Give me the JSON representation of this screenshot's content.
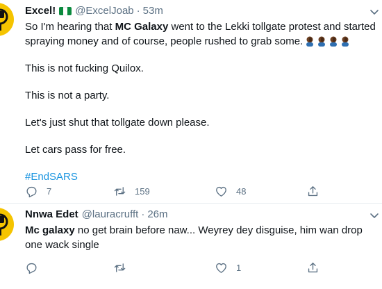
{
  "tweets": [
    {
      "author": {
        "name": "Excel!",
        "handle": "@ExcelJoab",
        "flag": "nigeria-flag",
        "avatar_color": "#f5c400"
      },
      "separator": "·",
      "time": "53m",
      "body": {
        "line1_pre": "So I'm hearing that ",
        "line1_bold": "MC Galaxy",
        "line1_post": " went to the Lekki tollgate protest and started spraying money and of course, people rushed to grab some.",
        "emoji": "person-facepalming-emoji",
        "p2": "This is not fucking Quilox.",
        "p3": "This is not a party.",
        "p4": "Let's just shut that tollgate down please.",
        "p5": "Let cars pass for free.",
        "hashtag": "#EndSARS"
      },
      "actions": {
        "replies": "7",
        "retweets": "159",
        "likes": "48"
      }
    },
    {
      "author": {
        "name": "Nnwa Edet",
        "handle": "@lauracrufft",
        "avatar_color": "#f5c400"
      },
      "separator": "·",
      "time": "26m",
      "body": {
        "bold": "Mc galaxy",
        "text": " no get brain before naw... Weyrey dey disguise, him wan drop one wack single"
      },
      "actions": {
        "replies": "",
        "retweets": "",
        "likes": "1"
      }
    }
  ],
  "colors": {
    "text": "#0f1419",
    "muted": "#5b7083",
    "link": "#1b95e0",
    "divider": "#e6ecf0"
  }
}
